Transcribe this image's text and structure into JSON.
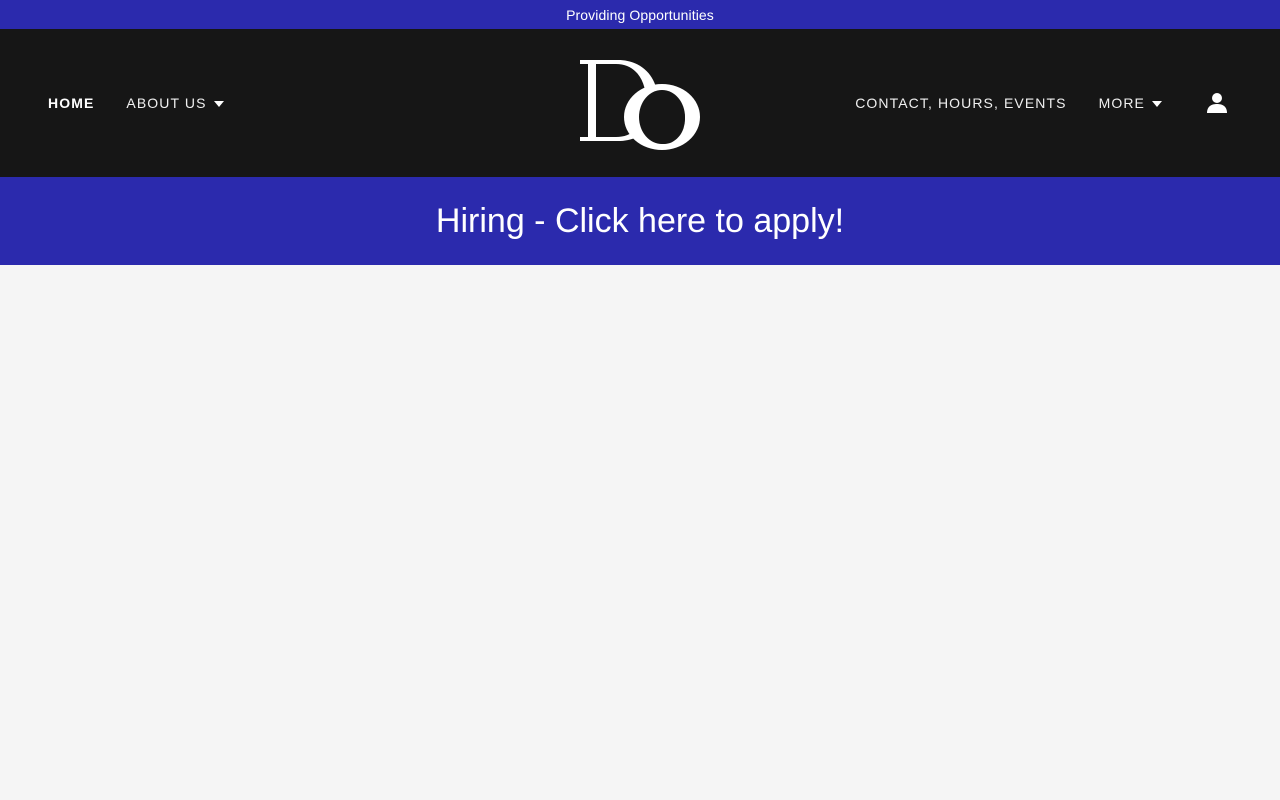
{
  "announcement": {
    "text": "Providing Opportunities"
  },
  "nav_left": [
    {
      "label": "HOME",
      "active": true
    },
    {
      "label": "ABOUT US",
      "dropdown": true
    }
  ],
  "logo": {
    "letters": "DO"
  },
  "nav_right": [
    {
      "label": "CONTACT, HOURS, EVENTS"
    },
    {
      "label": "MORE",
      "dropdown": true
    }
  ],
  "hiring_banner": {
    "text": "Hiring - Click here to apply!"
  },
  "colors": {
    "brand_blue": "#2b2aad",
    "header_bg": "#161616",
    "page_bg": "#f5f5f5",
    "text_white": "#ffffff"
  },
  "icons": {
    "account": "user-icon",
    "dropdown": "caret-down-icon"
  }
}
